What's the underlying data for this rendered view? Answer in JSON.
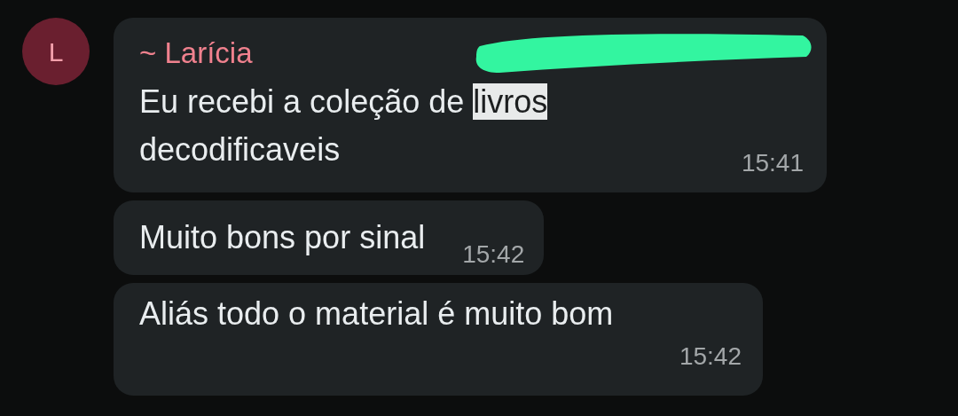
{
  "sender": {
    "avatar_letter": "L",
    "name": "~ Larícia",
    "redacted": true
  },
  "messages": [
    {
      "segments": [
        {
          "text": "Eu recebi a coleção de ",
          "selected": false
        },
        {
          "text": "livros",
          "selected": true
        },
        {
          "text": "\ndecodificaveis",
          "selected": false
        }
      ],
      "time": "15:41"
    },
    {
      "segments": [
        {
          "text": "Muito bons por sinal",
          "selected": false
        }
      ],
      "time": "15:42"
    },
    {
      "segments": [
        {
          "text": "Aliás todo o material é muito bom",
          "selected": false
        }
      ],
      "time": "15:42"
    }
  ]
}
